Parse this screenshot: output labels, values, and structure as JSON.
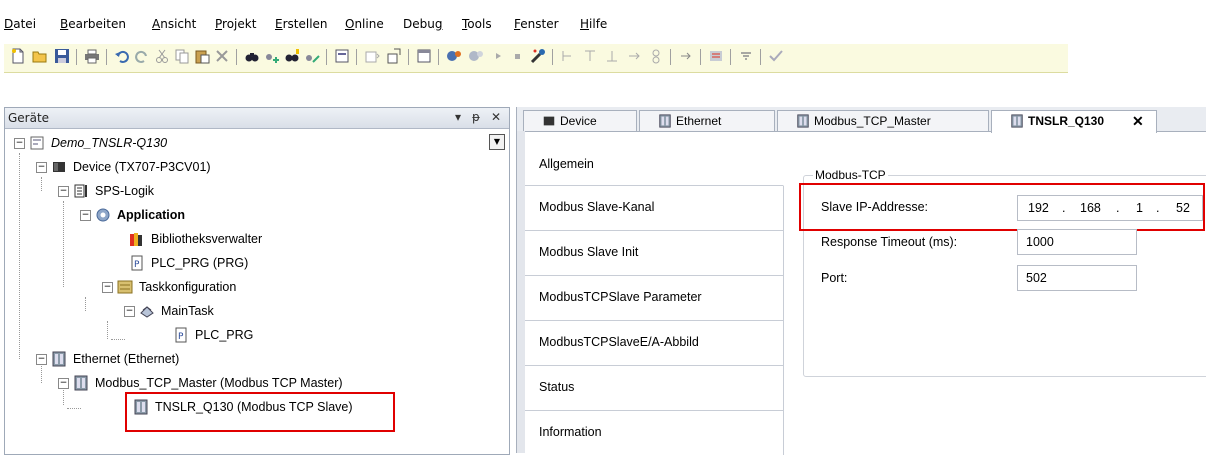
{
  "menu": {
    "items": [
      {
        "pre": "",
        "u": "D",
        "post": "atei"
      },
      {
        "pre": "",
        "u": "B",
        "post": "earbeiten"
      },
      {
        "pre": "",
        "u": "A",
        "post": "nsicht"
      },
      {
        "pre": "",
        "u": "P",
        "post": "rojekt"
      },
      {
        "pre": "",
        "u": "E",
        "post": "rstellen"
      },
      {
        "pre": "",
        "u": "O",
        "post": "nline"
      },
      {
        "pre": "Debu",
        "u": "g",
        "post": ""
      },
      {
        "pre": "",
        "u": "T",
        "post": "ools"
      },
      {
        "pre": "",
        "u": "F",
        "post": "enster"
      },
      {
        "pre": "",
        "u": "H",
        "post": "ilfe"
      }
    ]
  },
  "devices": {
    "title": "Geräte",
    "pin": "ᵽ",
    "close": "✕",
    "dropdown": "▾",
    "tree": [
      {
        "label": "Demo_TNSLR-Q130",
        "italic": true,
        "bold": false
      },
      {
        "label": "Device (TX707-P3CV01)",
        "italic": false,
        "bold": false
      },
      {
        "label": "SPS-Logik",
        "italic": false,
        "bold": false
      },
      {
        "label": "Application",
        "italic": false,
        "bold": true
      },
      {
        "label": "Bibliotheksverwalter",
        "italic": false,
        "bold": false
      },
      {
        "label": "PLC_PRG (PRG)",
        "italic": false,
        "bold": false
      },
      {
        "label": "Taskkonfiguration",
        "italic": false,
        "bold": false
      },
      {
        "label": "MainTask",
        "italic": false,
        "bold": false
      },
      {
        "label": "PLC_PRG",
        "italic": false,
        "bold": false
      },
      {
        "label": "Ethernet (Ethernet)",
        "italic": false,
        "bold": false
      },
      {
        "label": "Modbus_TCP_Master (Modbus TCP Master)",
        "italic": false,
        "bold": false
      },
      {
        "label": "TNSLR_Q130 (Modbus TCP Slave)",
        "italic": false,
        "bold": false
      }
    ]
  },
  "tabs": [
    {
      "label": "Device"
    },
    {
      "label": "Ethernet"
    },
    {
      "label": "Modbus_TCP_Master"
    },
    {
      "label": "TNSLR_Q130",
      "close": "✕"
    }
  ],
  "sidenav": [
    {
      "label": "Allgemein"
    },
    {
      "label": "Modbus Slave-Kanal"
    },
    {
      "label": "Modbus Slave Init"
    },
    {
      "label": "ModbusTCPSlave Parameter"
    },
    {
      "label": "ModbusTCPSlaveE/A-Abbild"
    },
    {
      "label": "Status"
    },
    {
      "label": "Information"
    }
  ],
  "config": {
    "group_title": "Modbus-TCP",
    "slave_ip_label": "Slave IP-Addresse:",
    "ip": [
      "192",
      ".",
      "168",
      ".",
      "1",
      ".",
      "52"
    ],
    "timeout_label": "Response Timeout (ms):",
    "timeout_value": "1000",
    "port_label": "Port:",
    "port_value": "502"
  },
  "colors": {
    "highlight": "#e00000",
    "toolbar_bg": "#fafae0"
  }
}
